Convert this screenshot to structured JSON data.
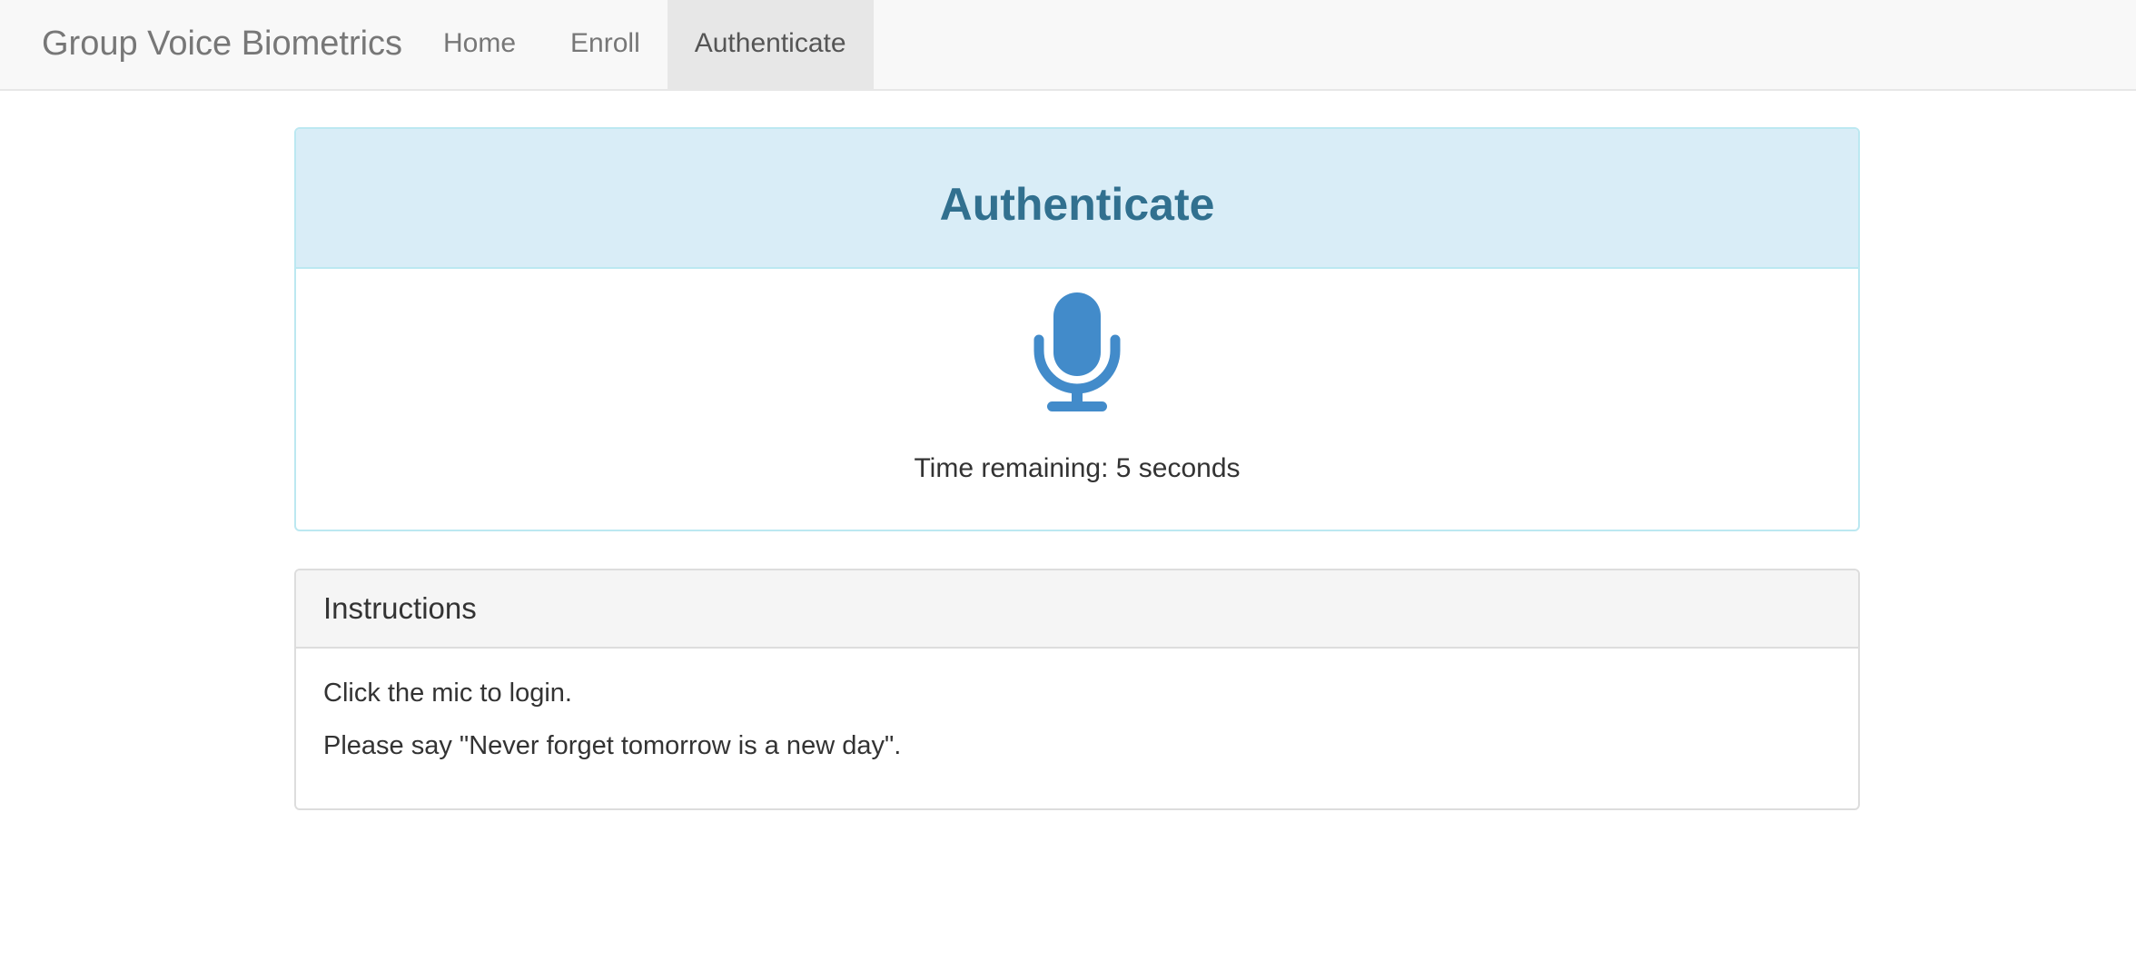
{
  "navbar": {
    "brand": "Group Voice Biometrics",
    "items": [
      {
        "label": "Home",
        "active": false
      },
      {
        "label": "Enroll",
        "active": false
      },
      {
        "label": "Authenticate",
        "active": true
      }
    ]
  },
  "auth_panel": {
    "title": "Authenticate",
    "mic_icon": "microphone-icon",
    "time_remaining": "Time remaining: 5 seconds"
  },
  "instructions_panel": {
    "title": "Instructions",
    "lines": [
      "Click the mic to login.",
      "Please say \"Never forget tomorrow is a new day\"."
    ]
  },
  "colors": {
    "navbar_bg": "#f8f8f8",
    "info_heading_bg": "#d9edf7",
    "info_title": "#31708f",
    "mic": "#428bca",
    "panel_default_heading_bg": "#f5f5f5"
  }
}
